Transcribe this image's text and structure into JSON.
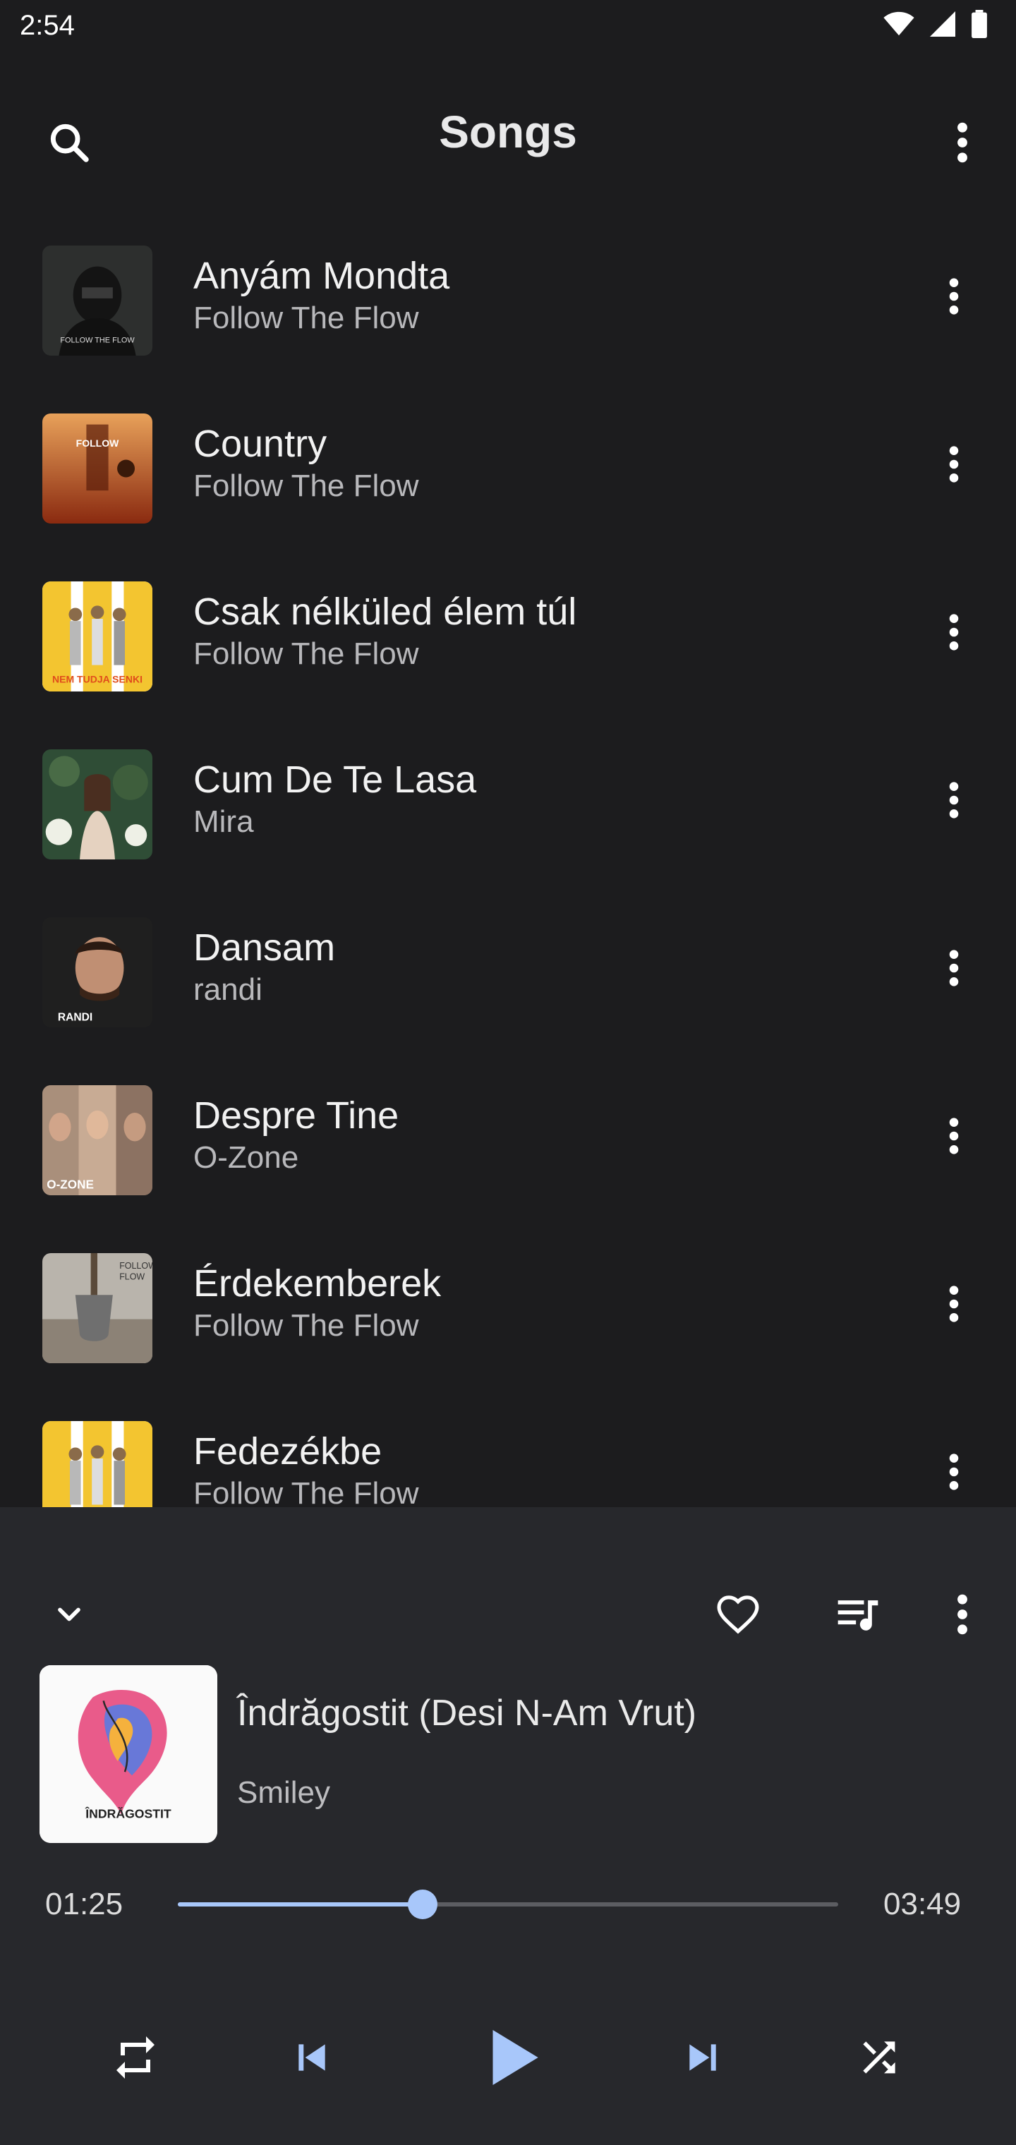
{
  "status": {
    "time": "2:54"
  },
  "header": {
    "title": "Songs"
  },
  "songs": [
    {
      "title": "Anyám Mondta",
      "artist": "Follow The Flow",
      "art": "dark-hood"
    },
    {
      "title": "Country",
      "artist": "Follow The Flow",
      "art": "orange-fire"
    },
    {
      "title": "Csak nélküled élem túl",
      "artist": "Follow The Flow",
      "art": "yellow-group"
    },
    {
      "title": "Cum De Te Lasa",
      "artist": "Mira",
      "art": "forest-woman"
    },
    {
      "title": "Dansam",
      "artist": "randi",
      "art": "portrait-man"
    },
    {
      "title": "Despre Tine",
      "artist": "O-Zone",
      "art": "ozone"
    },
    {
      "title": "Érdekemberek",
      "artist": "Follow The Flow",
      "art": "shovel"
    },
    {
      "title": "Fedezékbe",
      "artist": "Follow The Flow",
      "art": "yellow-group"
    }
  ],
  "player": {
    "title": "Îndrăgostit (Desi N-Am Vrut)",
    "artist": "Smiley",
    "elapsed": "01:25",
    "duration": "03:49",
    "progress": 0.371,
    "accent": "#a8c7fa"
  }
}
